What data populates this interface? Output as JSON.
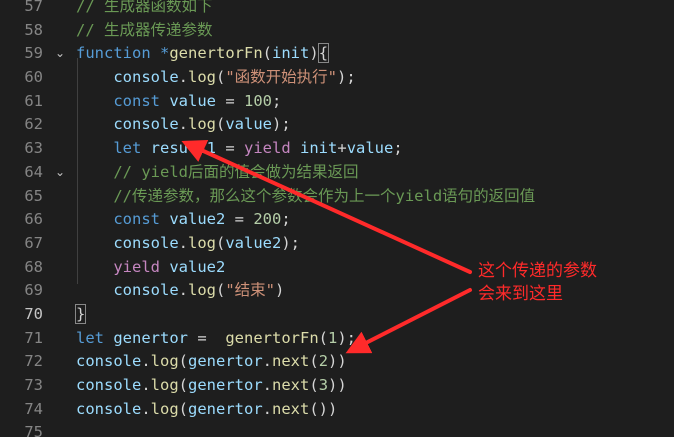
{
  "editor": {
    "lines": [
      {
        "num": "57",
        "fold": "",
        "tokens": [
          {
            "c": "cm",
            "t": "// 生成器函数如下"
          }
        ]
      },
      {
        "num": "58",
        "fold": "",
        "tokens": [
          {
            "c": "cm",
            "t": "// 生成器传递参数"
          }
        ]
      },
      {
        "num": "59",
        "fold": "⌄",
        "tokens": [
          {
            "c": "kw",
            "t": "function"
          },
          {
            "c": "op",
            "t": " "
          },
          {
            "c": "kw",
            "t": "*"
          },
          {
            "c": "fn",
            "t": "genertorFn"
          },
          {
            "c": "op",
            "t": "("
          },
          {
            "c": "var",
            "t": "init"
          },
          {
            "c": "op",
            "t": ")"
          },
          {
            "c": "bracket",
            "t": "{"
          }
        ]
      },
      {
        "num": "60",
        "fold": "",
        "tokens": [
          {
            "c": "op",
            "t": "    "
          },
          {
            "c": "var",
            "t": "console"
          },
          {
            "c": "op",
            "t": "."
          },
          {
            "c": "fn",
            "t": "log"
          },
          {
            "c": "op",
            "t": "("
          },
          {
            "c": "str",
            "t": "\"函数开始执行\""
          },
          {
            "c": "op",
            "t": ");"
          }
        ]
      },
      {
        "num": "61",
        "fold": "",
        "tokens": [
          {
            "c": "op",
            "t": "    "
          },
          {
            "c": "kw",
            "t": "const"
          },
          {
            "c": "op",
            "t": " "
          },
          {
            "c": "var",
            "t": "value"
          },
          {
            "c": "op",
            "t": " = "
          },
          {
            "c": "num",
            "t": "100"
          },
          {
            "c": "op",
            "t": ";"
          }
        ]
      },
      {
        "num": "62",
        "fold": "",
        "tokens": [
          {
            "c": "op",
            "t": "    "
          },
          {
            "c": "var",
            "t": "console"
          },
          {
            "c": "op",
            "t": "."
          },
          {
            "c": "fn",
            "t": "log"
          },
          {
            "c": "op",
            "t": "("
          },
          {
            "c": "var",
            "t": "value"
          },
          {
            "c": "op",
            "t": ");"
          }
        ]
      },
      {
        "num": "63",
        "fold": "",
        "tokens": [
          {
            "c": "op",
            "t": "    "
          },
          {
            "c": "kw",
            "t": "let"
          },
          {
            "c": "op",
            "t": " "
          },
          {
            "c": "var",
            "t": "result1"
          },
          {
            "c": "op",
            "t": " = "
          },
          {
            "c": "ctl",
            "t": "yield"
          },
          {
            "c": "op",
            "t": " "
          },
          {
            "c": "var",
            "t": "init"
          },
          {
            "c": "op",
            "t": "+"
          },
          {
            "c": "var",
            "t": "value"
          },
          {
            "c": "op",
            "t": ";"
          }
        ]
      },
      {
        "num": "64",
        "fold": "⌄",
        "tokens": [
          {
            "c": "op",
            "t": "    "
          },
          {
            "c": "cm",
            "t": "// yield后面的值会做为结果返回"
          }
        ]
      },
      {
        "num": "65",
        "fold": "",
        "tokens": [
          {
            "c": "op",
            "t": "    "
          },
          {
            "c": "cm",
            "t": "//传递参数，那么这个参数会作为上一个yield语句的返回值"
          }
        ]
      },
      {
        "num": "66",
        "fold": "",
        "tokens": [
          {
            "c": "op",
            "t": "    "
          },
          {
            "c": "kw",
            "t": "const"
          },
          {
            "c": "op",
            "t": " "
          },
          {
            "c": "var",
            "t": "value2"
          },
          {
            "c": "op",
            "t": " = "
          },
          {
            "c": "num",
            "t": "200"
          },
          {
            "c": "op",
            "t": ";"
          }
        ]
      },
      {
        "num": "67",
        "fold": "",
        "tokens": [
          {
            "c": "op",
            "t": "    "
          },
          {
            "c": "var",
            "t": "console"
          },
          {
            "c": "op",
            "t": "."
          },
          {
            "c": "fn",
            "t": "log"
          },
          {
            "c": "op",
            "t": "("
          },
          {
            "c": "var",
            "t": "value2"
          },
          {
            "c": "op",
            "t": ");"
          }
        ]
      },
      {
        "num": "68",
        "fold": "",
        "tokens": [
          {
            "c": "op",
            "t": "    "
          },
          {
            "c": "ctl",
            "t": "yield"
          },
          {
            "c": "op",
            "t": " "
          },
          {
            "c": "var",
            "t": "value2"
          }
        ]
      },
      {
        "num": "69",
        "fold": "",
        "tokens": [
          {
            "c": "op",
            "t": "    "
          },
          {
            "c": "var",
            "t": "console"
          },
          {
            "c": "op",
            "t": "."
          },
          {
            "c": "fn",
            "t": "log"
          },
          {
            "c": "op",
            "t": "("
          },
          {
            "c": "str",
            "t": "\"结束\""
          },
          {
            "c": "op",
            "t": ")"
          }
        ]
      },
      {
        "num": "70",
        "fold": "",
        "current": true,
        "tokens": [
          {
            "c": "bracket",
            "t": "}"
          }
        ]
      },
      {
        "num": "71",
        "fold": "",
        "tokens": [
          {
            "c": "kw",
            "t": "let"
          },
          {
            "c": "op",
            "t": " "
          },
          {
            "c": "var",
            "t": "genertor"
          },
          {
            "c": "op",
            "t": " =  "
          },
          {
            "c": "fn",
            "t": "genertorFn"
          },
          {
            "c": "op",
            "t": "("
          },
          {
            "c": "num",
            "t": "1"
          },
          {
            "c": "op",
            "t": ");"
          }
        ]
      },
      {
        "num": "72",
        "fold": "",
        "tokens": [
          {
            "c": "var",
            "t": "console"
          },
          {
            "c": "op",
            "t": "."
          },
          {
            "c": "fn",
            "t": "log"
          },
          {
            "c": "op",
            "t": "("
          },
          {
            "c": "var",
            "t": "genertor"
          },
          {
            "c": "op",
            "t": "."
          },
          {
            "c": "fn",
            "t": "next"
          },
          {
            "c": "op",
            "t": "("
          },
          {
            "c": "num",
            "t": "2"
          },
          {
            "c": "op",
            "t": "))"
          }
        ]
      },
      {
        "num": "73",
        "fold": "",
        "tokens": [
          {
            "c": "var",
            "t": "console"
          },
          {
            "c": "op",
            "t": "."
          },
          {
            "c": "fn",
            "t": "log"
          },
          {
            "c": "op",
            "t": "("
          },
          {
            "c": "var",
            "t": "genertor"
          },
          {
            "c": "op",
            "t": "."
          },
          {
            "c": "fn",
            "t": "next"
          },
          {
            "c": "op",
            "t": "("
          },
          {
            "c": "num",
            "t": "3"
          },
          {
            "c": "op",
            "t": "))"
          }
        ]
      },
      {
        "num": "74",
        "fold": "",
        "tokens": [
          {
            "c": "var",
            "t": "console"
          },
          {
            "c": "op",
            "t": "."
          },
          {
            "c": "fn",
            "t": "log"
          },
          {
            "c": "op",
            "t": "("
          },
          {
            "c": "var",
            "t": "genertor"
          },
          {
            "c": "op",
            "t": "."
          },
          {
            "c": "fn",
            "t": "next"
          },
          {
            "c": "op",
            "t": "())"
          }
        ]
      },
      {
        "num": "75",
        "fold": "",
        "tokens": []
      }
    ]
  },
  "annotation": {
    "line1": "这个传递的参数",
    "line2": "会来到这里",
    "color": "#ff2a2a"
  },
  "theme": {
    "background": "#1e1e1e",
    "keyword": "#569cd6",
    "control": "#c586c0",
    "function": "#dcdcaa",
    "variable": "#9cdcfe",
    "string": "#ce9178",
    "number": "#b5cea8",
    "comment": "#6a9955"
  }
}
